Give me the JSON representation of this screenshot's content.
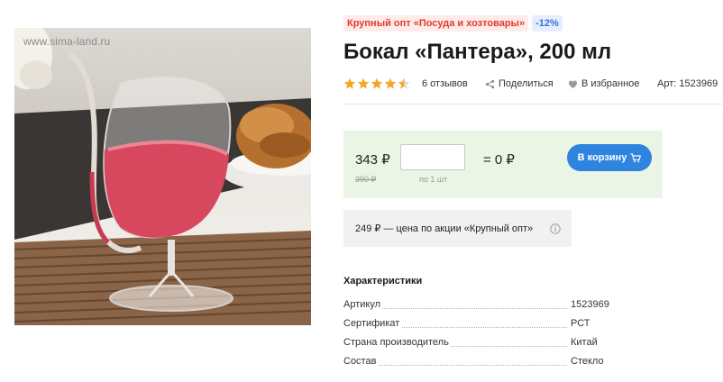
{
  "image": {
    "watermark": "www.sima-land.ru"
  },
  "badges": {
    "promo": "Крупный опт «Посуда и хозтовары»",
    "discount": "-12%"
  },
  "product": {
    "title": "Бокал «Пантера», 200 мл",
    "rating": 4.5,
    "reviews": "6 отзывов",
    "share": "Поделиться",
    "favorites": "В избранное",
    "article": "Арт: 1523969"
  },
  "buy": {
    "price": "343 ₽",
    "old_price": "390 ₽",
    "qty_value": "",
    "per_unit": "по 1 шт",
    "total": "= 0 ₽",
    "cart_button": "В корзину"
  },
  "promo": {
    "text": "249 ₽ — цена по акции «Крупный опт»"
  },
  "specs": {
    "heading": "Характеристики",
    "rows": [
      {
        "key": "Артикул",
        "value": "1523969"
      },
      {
        "key": "Сертификат",
        "value": "РСТ"
      },
      {
        "key": "Страна производитель",
        "value": "Китай"
      },
      {
        "key": "Состав",
        "value": "Стекло"
      }
    ]
  },
  "colors": {
    "promo_badge": "#e23a2c",
    "discount_badge": "#3a6fd8",
    "star": "#f5a623",
    "buybox_bg": "#eaf5e6",
    "cart_button": "#2f84e0"
  }
}
